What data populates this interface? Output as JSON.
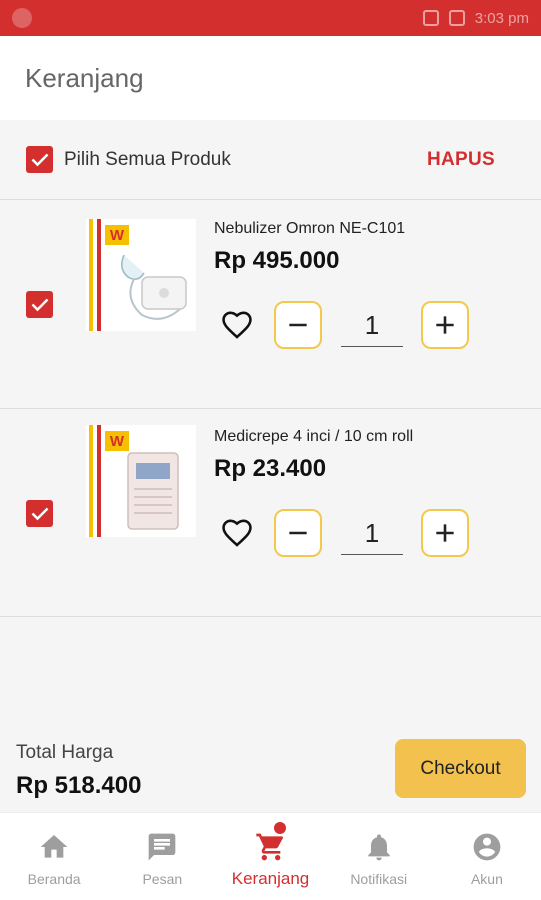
{
  "status_bar": {
    "time": "3:03 pm"
  },
  "header": {
    "title": "Keranjang"
  },
  "select_all": {
    "label": "Pilih Semua Produk",
    "delete_label": "HAPUS",
    "checked": true
  },
  "cart": {
    "items": [
      {
        "name": "Nebulizer Omron NE-C101",
        "price": "Rp 495.000",
        "quantity": "1",
        "checked": true,
        "image_icon": "nebulizer-image"
      },
      {
        "name": "Medicrepe 4 inci / 10 cm roll",
        "price": "Rp 23.400",
        "quantity": "1",
        "checked": true,
        "image_icon": "bandage-roll-image"
      }
    ]
  },
  "summary": {
    "total_label": "Total Harga",
    "total_value": "Rp 518.400",
    "checkout_label": "Checkout"
  },
  "bottom_nav": {
    "items": [
      {
        "label": "Beranda",
        "icon": "home-icon",
        "active": false
      },
      {
        "label": "Pesan",
        "icon": "message-icon",
        "active": false
      },
      {
        "label": "Keranjang",
        "icon": "cart-icon",
        "active": true
      },
      {
        "label": "Notifikasi",
        "icon": "bell-icon",
        "active": false
      },
      {
        "label": "Akun",
        "icon": "account-icon",
        "active": false
      }
    ]
  },
  "colors": {
    "brand_red": "#d32f2f",
    "accent_yellow": "#f2c14e",
    "muted": "#9e9e9e"
  }
}
